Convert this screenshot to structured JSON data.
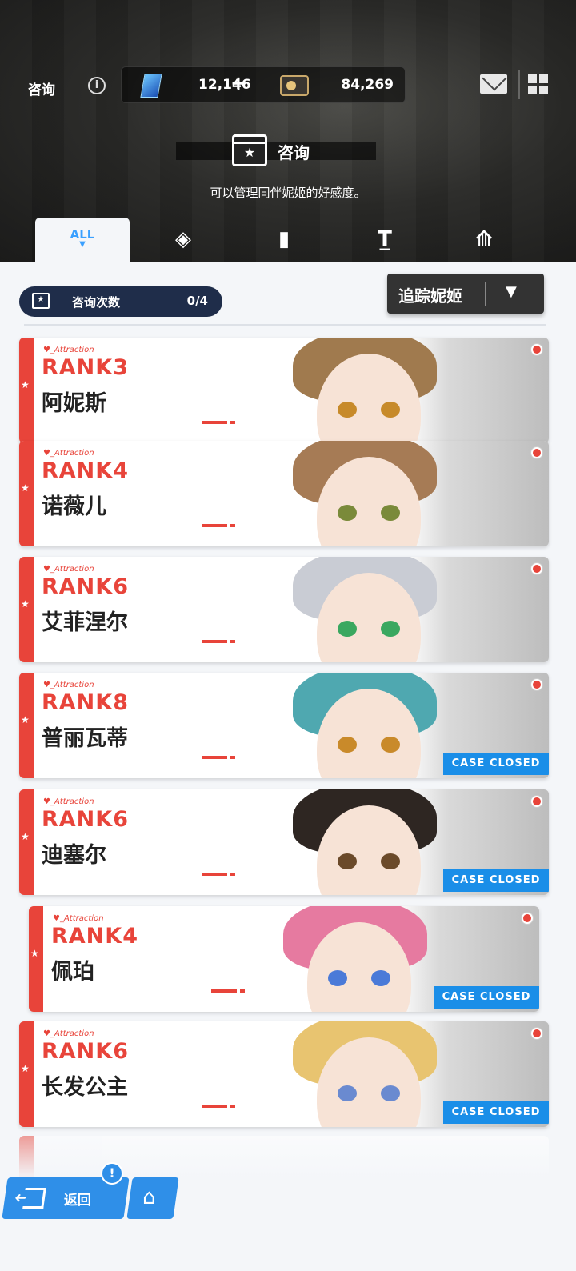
{
  "header": {
    "title": "咨询",
    "gems": "12,146",
    "plus": "+",
    "credits": "84,269",
    "section_title": "咨询",
    "section_subtitle": "可以管理同伴妮姬的好感度。"
  },
  "tabs": [
    {
      "label": "ALL",
      "caret": "▼",
      "active": true
    },
    {
      "icon": "diamond-grid-icon",
      "glyph": "◈"
    },
    {
      "icon": "pillar-icon",
      "glyph": "▮"
    },
    {
      "icon": "t-bar-icon",
      "glyph": "T̲"
    },
    {
      "icon": "emblem-icon",
      "glyph": "⟰"
    }
  ],
  "counseling": {
    "label": "咨询次数",
    "value": "0/4"
  },
  "track": {
    "label": "追踪妮姬",
    "arrow": "▼"
  },
  "attraction_label": "Attraction",
  "cards": [
    {
      "rank": "RANK3",
      "name": "阿妮斯",
      "case_closed": false,
      "hair_color": "#a07a4e",
      "eye_color": "#c78a2a"
    },
    {
      "rank": "RANK4",
      "name": "诺薇儿",
      "case_closed": false,
      "hair_color": "#a67b55",
      "eye_color": "#7a8a3a"
    },
    {
      "rank": "RANK6",
      "name": "艾菲涅尔",
      "case_closed": false,
      "hair_color": "#c9ccd4",
      "eye_color": "#3aa860"
    },
    {
      "rank": "RANK8",
      "name": "普丽瓦蒂",
      "case_closed": true,
      "hair_color": "#4fa8b0",
      "eye_color": "#c98a2a"
    },
    {
      "rank": "RANK6",
      "name": "迪塞尔",
      "case_closed": true,
      "hair_color": "#2e2622",
      "eye_color": "#6b4a2a"
    },
    {
      "rank": "RANK4",
      "name": "佩珀",
      "case_closed": true,
      "hair_color": "#e67aa0",
      "eye_color": "#4a7ad8"
    },
    {
      "rank": "RANK6",
      "name": "长发公主",
      "case_closed": true,
      "hair_color": "#e8c470",
      "eye_color": "#6a8ad0"
    }
  ],
  "case_closed_label": "CASE CLOSED",
  "bottom": {
    "back_label": "返回",
    "alert": "!"
  },
  "colors": {
    "accent_red": "#e8443a",
    "accent_blue": "#2f8fe8",
    "case_closed_blue": "#1a8ee8"
  }
}
